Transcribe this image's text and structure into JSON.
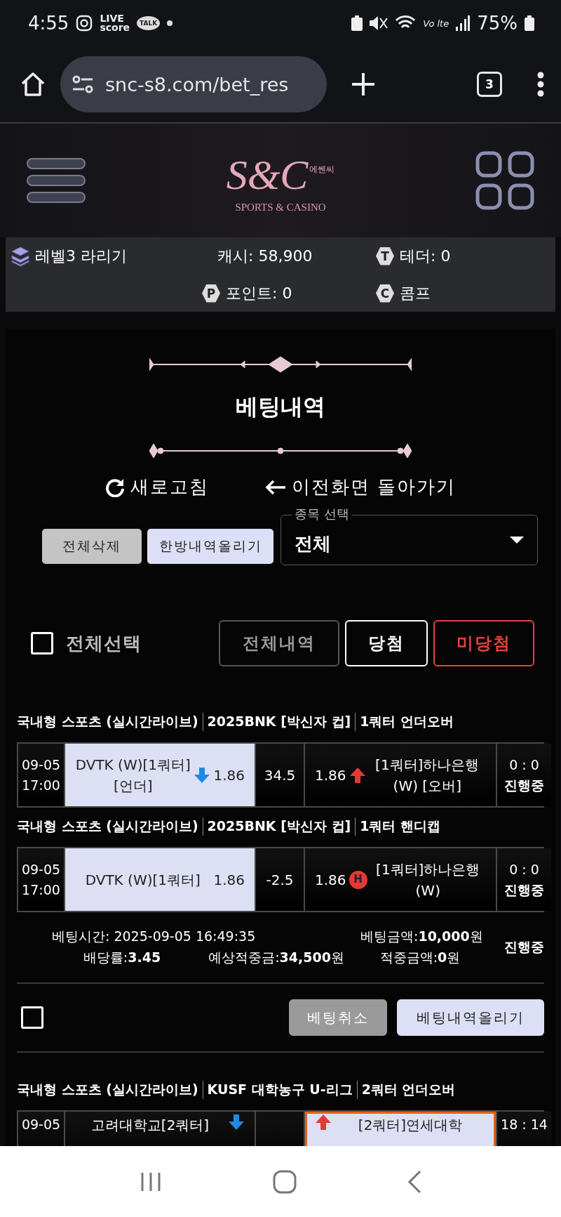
{
  "status_bar": {
    "time": "4:55",
    "live_app": [
      "LIVE",
      "score"
    ],
    "talk_app": "TALK",
    "network": "Vo lte",
    "battery": "75%"
  },
  "browser": {
    "url": "snc-s8.com/bet_res",
    "tab_count": "3"
  },
  "header": {
    "logo": {
      "mark": "S&C",
      "korean": "에쎈씨",
      "tagline": "SPORTS & CASINO"
    }
  },
  "account": {
    "level": "레벨3 라리기",
    "cash": "캐시: 58,900",
    "tether": {
      "badge": "T",
      "label": "테더: 0"
    },
    "points": {
      "badge": "P",
      "label": "포인트: 0"
    },
    "comp": {
      "badge": "C",
      "label": "콤프"
    }
  },
  "page": {
    "title": "베팅내역",
    "refresh": "새로고침",
    "back": "이전화면 돌아가기"
  },
  "controls": {
    "buttons": [
      {
        "label": "전체삭제",
        "kind": "grey"
      },
      {
        "label": "한방내역올리기",
        "kind": "light"
      }
    ],
    "sport_select": {
      "label": "종목 선택",
      "value": "전체"
    }
  },
  "filter": {
    "select_all": {
      "label": "전체선택",
      "checked": false
    },
    "tabs": [
      {
        "label": "전체내역",
        "color": "#9a9a9a"
      },
      {
        "label": "당첨",
        "color": "#ffffff"
      },
      {
        "label": "미당첨",
        "color": "#e8413c"
      }
    ]
  },
  "bets": [
    {
      "legs": [
        {
          "header": [
            "국내형 스포츠 (실시간라이브)",
            "2025BNK [박신자 컵]",
            "1쿼터 언더오버"
          ],
          "date": "09-05",
          "time": "17:00",
          "home": {
            "name": "DVTK (W)[1쿼터] [언더]",
            "odds": "1.86",
            "selected": true,
            "marker": {
              "kind": "down"
            }
          },
          "line": "34.5",
          "away": {
            "name": "[1쿼터]하나은행 (W) [오버]",
            "odds": "1.86",
            "selected": false,
            "marker": {
              "kind": "up"
            }
          },
          "score": "0 : 0",
          "status": "진행중"
        },
        {
          "header": [
            "국내형 스포츠 (실시간라이브)",
            "2025BNK [박신자 컵]",
            "1쿼터 핸디캡"
          ],
          "date": "09-05",
          "time": "17:00",
          "home": {
            "name": "DVTK (W)[1쿼터]",
            "odds": "1.86",
            "selected": true
          },
          "line": "-2.5",
          "away": {
            "name": "[1쿼터]하나은행 (W)",
            "odds": "1.86",
            "selected": false,
            "marker": {
              "kind": "badge",
              "label": "H"
            }
          },
          "score": "0 : 0",
          "status": "진행중"
        }
      ],
      "summary": {
        "bet_time": "베팅시간: 2025-09-05 16:49:35",
        "bet_amount": "베팅금액:**10,000**원",
        "odds": "배당률:**3.45**",
        "expected": "예상적중금:**34,500**원",
        "won": "적중금액:**0**원",
        "status": "진행중"
      },
      "checked": false,
      "actions": [
        {
          "label": "베팅취소",
          "kind": "grey"
        },
        {
          "label": "베팅내역올리기",
          "kind": "light"
        }
      ]
    },
    {
      "legs": [
        {
          "header": [
            "국내형 스포츠 (실시간라이브)",
            "KUSF 대학농구 U-리그",
            "2쿼터 언더오버"
          ],
          "date": "09-05",
          "home": {
            "name": "고려대학교[2쿼터]",
            "selected": false,
            "marker": {
              "kind": "down"
            }
          },
          "away": {
            "name": "[2쿼터]연세대학",
            "selected": true,
            "marker": {
              "kind": "up"
            }
          },
          "score": "18 : 14"
        }
      ]
    }
  ]
}
